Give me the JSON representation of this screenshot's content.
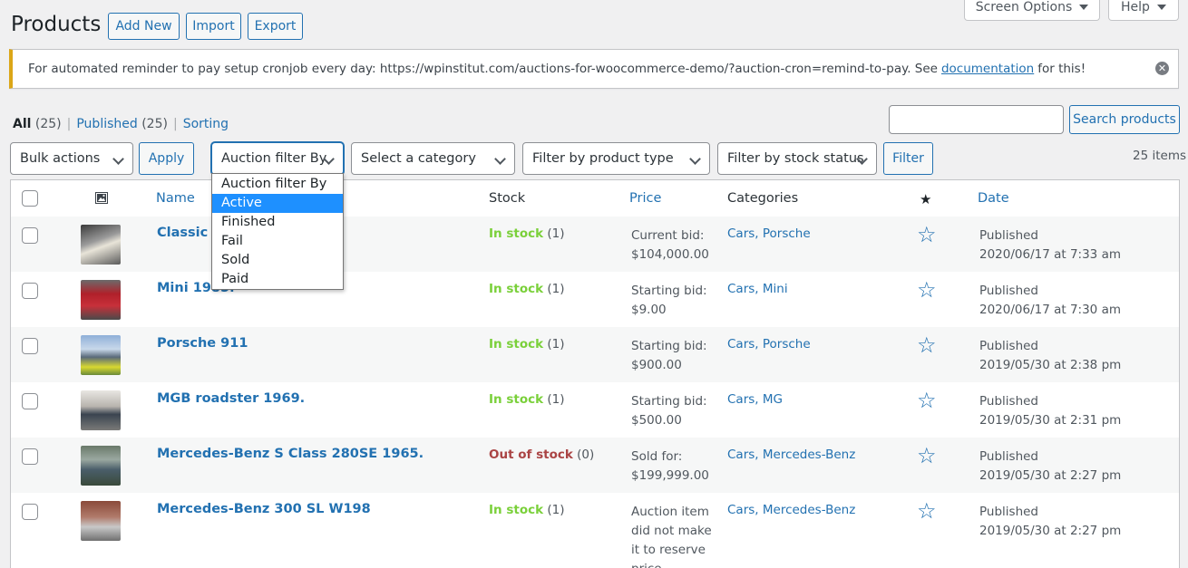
{
  "top_buttons": {
    "screen_options": "Screen Options",
    "help": "Help"
  },
  "header": {
    "title": "Products",
    "add_new": "Add New",
    "import": "Import",
    "export": "Export"
  },
  "notice": {
    "text_before": "For automated reminder to pay setup cronjob every day: https://wpinstitut.com/auctions-for-woocommerce-demo/?auction-cron=remind-to-pay. See",
    "link": "documentation",
    "text_after": "for this!"
  },
  "subsubsub": {
    "all": "All",
    "all_count": "(25)",
    "published": "Published",
    "published_count": "(25)",
    "sorting": "Sorting",
    "separator": "|"
  },
  "search": {
    "value": "",
    "button": "Search products"
  },
  "filters": {
    "bulk_actions": "Bulk actions",
    "apply": "Apply",
    "auction_filter": "Auction filter By",
    "category": "Select a category",
    "product_type": "Filter by product type",
    "stock_status": "Filter by stock status",
    "filter_button": "Filter",
    "items_count": "25 items"
  },
  "auction_dropdown": {
    "options": [
      "Auction filter By",
      "Active",
      "Finished",
      "Fail",
      "Sold",
      "Paid"
    ],
    "highlighted": "Active"
  },
  "table": {
    "columns": {
      "name": "Name",
      "stock": "Stock",
      "price": "Price",
      "categories": "Categories",
      "date": "Date",
      "image_icon": "image-icon",
      "featured_icon": "star-icon"
    },
    "rows": [
      {
        "name": "Classic P",
        "stock_status": "In stock",
        "stock_qty": "(1)",
        "price_line1": "Current bid:",
        "price_line2": "$104,000.00",
        "price_line3": "",
        "price_line4": "",
        "categories": "Cars, Porsche",
        "date_status": "Published",
        "date": "2020/06/17 at 7:33 am"
      },
      {
        "name": "Mini 1985.",
        "stock_status": "In stock",
        "stock_qty": "(1)",
        "price_line1": "Starting bid:",
        "price_line2": "$9.00",
        "price_line3": "",
        "price_line4": "",
        "categories": "Cars, Mini",
        "date_status": "Published",
        "date": "2020/06/17 at 7:30 am"
      },
      {
        "name": "Porsche 911",
        "stock_status": "In stock",
        "stock_qty": "(1)",
        "price_line1": "Starting bid:",
        "price_line2": "$900.00",
        "price_line3": "",
        "price_line4": "",
        "categories": "Cars, Porsche",
        "date_status": "Published",
        "date": "2019/05/30 at 2:38 pm"
      },
      {
        "name": "MGB roadster 1969.",
        "stock_status": "In stock",
        "stock_qty": "(1)",
        "price_line1": "Starting bid:",
        "price_line2": "$500.00",
        "price_line3": "",
        "price_line4": "",
        "categories": "Cars, MG",
        "date_status": "Published",
        "date": "2019/05/30 at 2:31 pm"
      },
      {
        "name": "Mercedes-Benz S Class 280SE 1965.",
        "stock_status": "Out of stock",
        "stock_qty": "(0)",
        "price_line1": "Sold for:",
        "price_line2": "$199,999.00",
        "price_line3": "",
        "price_line4": "",
        "categories": "Cars, Mercedes-Benz",
        "date_status": "Published",
        "date": "2019/05/30 at 2:27 pm"
      },
      {
        "name": "Mercedes-Benz 300 SL W198",
        "stock_status": "In stock",
        "stock_qty": "(1)",
        "price_line1": "Auction item",
        "price_line2": "did not make",
        "price_line3": "it to reserve",
        "price_line4": "price",
        "categories": "Cars, Mercedes-Benz",
        "date_status": "Published",
        "date": "2019/05/30 at 2:27 pm"
      }
    ]
  },
  "colors": {
    "accent": "#2271b1",
    "in_stock": "#7ad03a",
    "out_of_stock": "#aa4444",
    "notice_border": "#dba617",
    "dropdown_highlight": "#1e90ff"
  }
}
